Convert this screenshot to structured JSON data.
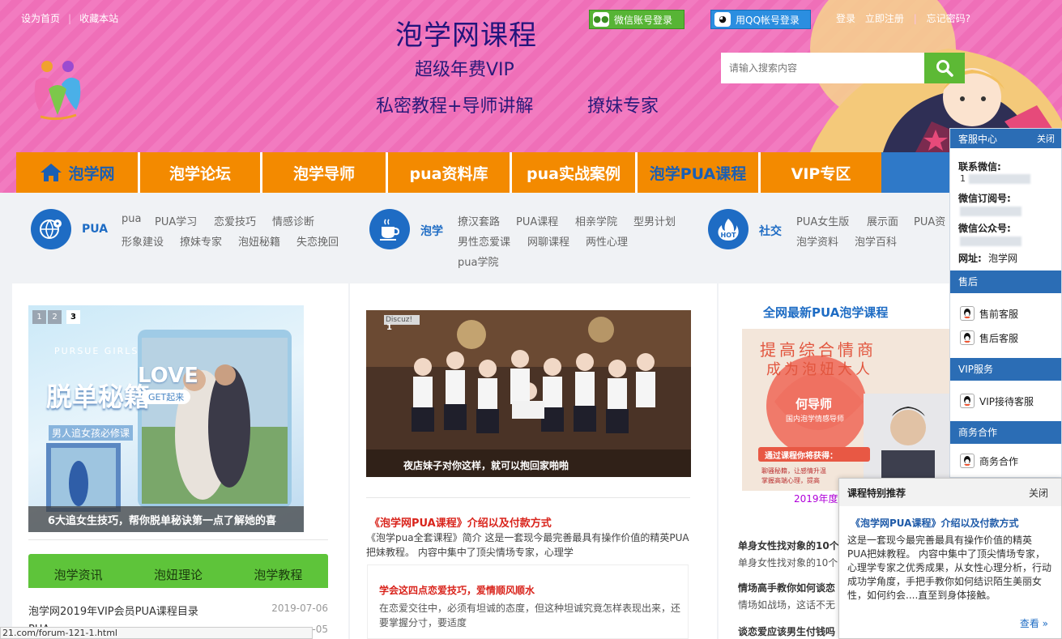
{
  "top_links": {
    "home": "设为首页",
    "bookmark": "收藏本站"
  },
  "title": {
    "main": "泡学网课程",
    "sub1": "超级年费VIP",
    "sub2": "私密教程+导师讲解",
    "sub3": "撩妹专家"
  },
  "login": {
    "wechat": "微信账号登录",
    "qq": "用QQ帐号登录",
    "login": "登录",
    "register": "立即注册",
    "forgot": "忘记密码?"
  },
  "search": {
    "placeholder": "请输入搜索内容"
  },
  "nav": [
    "泡学网",
    "泡学论坛",
    "泡学导师",
    "pua资料库",
    "pua实战案例",
    "泡学PUA课程",
    "VIP专区"
  ],
  "categories": [
    {
      "name": "PUA",
      "links": [
        "pua",
        "PUA学习",
        "恋爱技巧",
        "情感诊断",
        "形象建设",
        "撩妹专家",
        "泡妞秘籍",
        "失恋挽回"
      ]
    },
    {
      "name": "泡学",
      "links": [
        "撩汉套路",
        "PUA课程",
        "相亲学院",
        "型男计划",
        "男性恋爱课",
        "网聊课程",
        "两性心理",
        "pua学院"
      ]
    },
    {
      "name": "社交",
      "links": [
        "PUA女生版",
        "展示面",
        "PUA资",
        "泡学资料",
        "泡学百科"
      ]
    }
  ],
  "slider1": {
    "pages": [
      "1",
      "2",
      "3"
    ],
    "caption": "6大追女生技巧，帮你脱单秘诀第一点了解她的喜",
    "art_text": "脱单秘籍",
    "art_love": "LOVE",
    "art_get": "GET起来",
    "art_en": "PURSUE GIRLS",
    "art_sub": "男人追女孩必修课"
  },
  "tabs": [
    "泡学资讯",
    "泡妞理论",
    "泡学教程"
  ],
  "list": [
    {
      "title": "泡学网2019年VIP会员PUA课程目录",
      "date": "2019-07-06"
    },
    {
      "title": "PUA",
      "date": "-05"
    }
  ],
  "slider2": {
    "tag": "Discuz!",
    "num": "1",
    "caption": "夜店妹子对你这样，就可以抱回家啪啪"
  },
  "article": {
    "title": "《泡学网PUA课程》介绍以及付款方式",
    "body": "《泡学pua全套课程》简介 这是一套现今最完善最具有操作价值的精英PUA把妹教程。 内容中集中了顶尖情场专家，心理学"
  },
  "article2": {
    "title": "学会这四点恋爱技巧，爱情顺风顺水",
    "body": "在恋爱交往中，必须有坦诚的态度，但这种坦诚究竟怎样表现出来，还要掌握分寸，要适度"
  },
  "col3": {
    "title": "全网最新PUA泡学课程",
    "poster_line1": "提高综合情商",
    "poster_line2": "成为泡妞大人",
    "poster_name": "何导师",
    "poster_role": "国内泡学情感导师",
    "poster_box": "通过课程你将获得：",
    "poster_b1": "聊骚秘籍，让感情升温",
    "poster_b2": "掌握高端心理，提高",
    "date": "2019年度",
    "items": [
      {
        "title": "单身女性找对象的10个",
        "desc": "单身女性找对象的10个"
      },
      {
        "title": "情场高手教你如何谈恋",
        "desc": "情场如战场，这话不无"
      },
      {
        "title": "谈恋爱应该男生付钱吗",
        "desc": ""
      }
    ]
  },
  "service": {
    "head": "客服中心",
    "close": "关闭",
    "wechat_label": "联系微信:",
    "wechat_val": "1",
    "sub_label": "微信订阅号:",
    "pub_label": "微信公众号:",
    "site_label": "网址:",
    "site_val": "泡学网",
    "sections": [
      {
        "name": "售后",
        "items": [
          "售前客服",
          "售后客服"
        ]
      },
      {
        "name": "VIP服务",
        "items": [
          "VIP接待客服"
        ]
      },
      {
        "name": "商务合作",
        "items": [
          "商务合作"
        ]
      }
    ]
  },
  "popup": {
    "head": "课程特别推荐",
    "close": "关闭",
    "title": "《泡学网PUA课程》介绍以及付款方式",
    "body": "这是一套现今最完善最具有操作价值的精英PUA把妹教程。 内容中集中了顶尖情场专家，心理学专家之优秀成果，从女性心理分析，行动成功学角度，手把手教你如何结识陌生美丽女性，如何约会....直至到身体接触。",
    "more": "查看 »"
  },
  "status_url": "21.com/forum-121-1.html"
}
